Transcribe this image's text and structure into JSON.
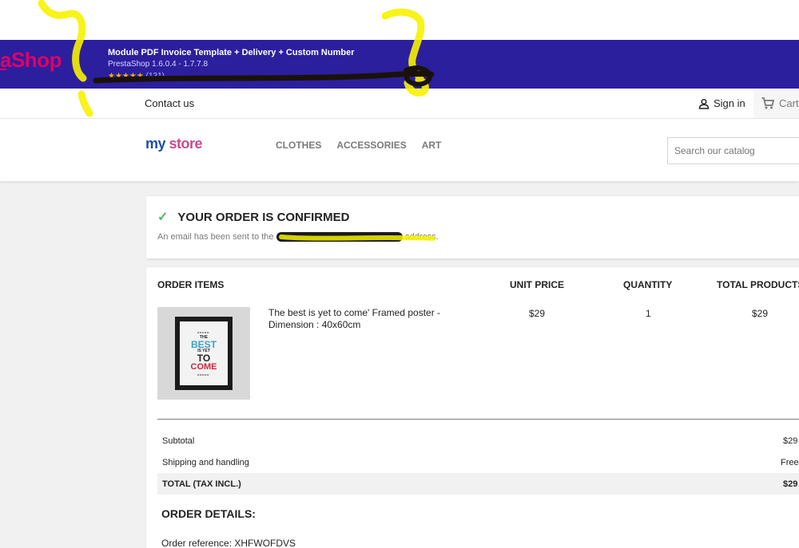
{
  "banner": {
    "brand": "aShop",
    "title": "Module PDF Invoice Template + Delivery + Custom Number",
    "version": "PrestaShop 1.6.0.4 - 1.7.7.8",
    "stars": "★★★★★",
    "rating_count": "(131)"
  },
  "nav": {
    "contact": "Contact us",
    "signin": "Sign in",
    "cart": "Cart"
  },
  "header": {
    "logo_part1": "my",
    "logo_part2": "store",
    "menu": [
      "CLOTHES",
      "ACCESSORIES",
      "ART"
    ],
    "search_placeholder": "Search our catalog"
  },
  "confirmation": {
    "title": "YOUR ORDER IS CONFIRMED",
    "text_before": "An email has been sent to the",
    "text_after": "address."
  },
  "order_items": {
    "headers": {
      "items": "ORDER ITEMS",
      "unit_price": "UNIT PRICE",
      "quantity": "QUANTITY",
      "total": "TOTAL PRODUCTS"
    },
    "rows": [
      {
        "name": "The best is yet to come' Framed poster - Dimension : 40x60cm",
        "unit_price": "$29",
        "quantity": "1",
        "total": "$29"
      }
    ],
    "poster_text": {
      "the": "THE",
      "best": "BEST",
      "yet": "IS YET",
      "to": "TO",
      "come": "COME"
    }
  },
  "summary": {
    "subtotal_label": "Subtotal",
    "subtotal_value": "$29",
    "shipping_label": "Shipping and handling",
    "shipping_value": "Free",
    "total_label": "TOTAL (TAX INCL.)",
    "total_value": "$29"
  },
  "details": {
    "title": "ORDER DETAILS:",
    "reference": "Order reference: XHFWOFDVS"
  },
  "colors": {
    "banner_bg": "#2b1f9e",
    "brand_pink": "#df0067",
    "check_green": "#4cbb6c",
    "highlight_yellow": "#f7f200"
  }
}
